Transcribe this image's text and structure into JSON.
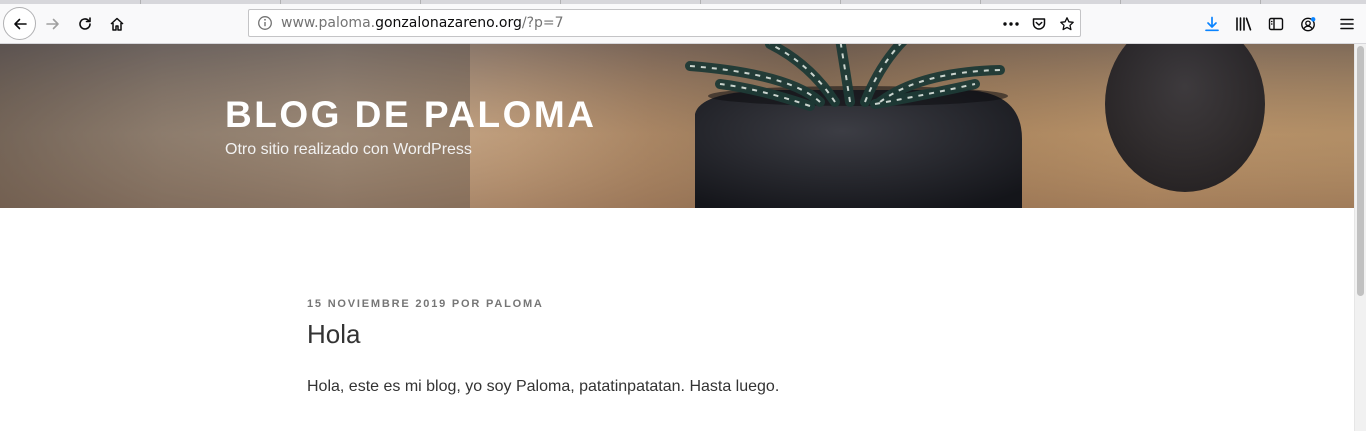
{
  "browser": {
    "url_prefix": "www.paloma.",
    "url_domain": "gonzalonazareno.org",
    "url_path": "/?p=7"
  },
  "site": {
    "title": "BLOG DE PALOMA",
    "description": "Otro sitio realizado con WordPress"
  },
  "post": {
    "date": "15 NOVIEMBRE 2019",
    "by": "POR",
    "author": "PALOMA",
    "title": "Hola",
    "body": "Hola, este es mi blog, yo soy Paloma, patatinpatatan. Hasta luego."
  },
  "colors": {
    "accent_download": "#0a84ff",
    "text": "#333333",
    "meta": "#767676"
  },
  "icons": [
    "back-arrow-icon",
    "forward-arrow-icon",
    "reload-icon",
    "home-icon",
    "info-icon",
    "more-actions-icon",
    "pocket-icon",
    "bookmark-star-icon",
    "download-icon",
    "library-icon",
    "sidebar-icon",
    "account-icon",
    "menu-icon"
  ]
}
